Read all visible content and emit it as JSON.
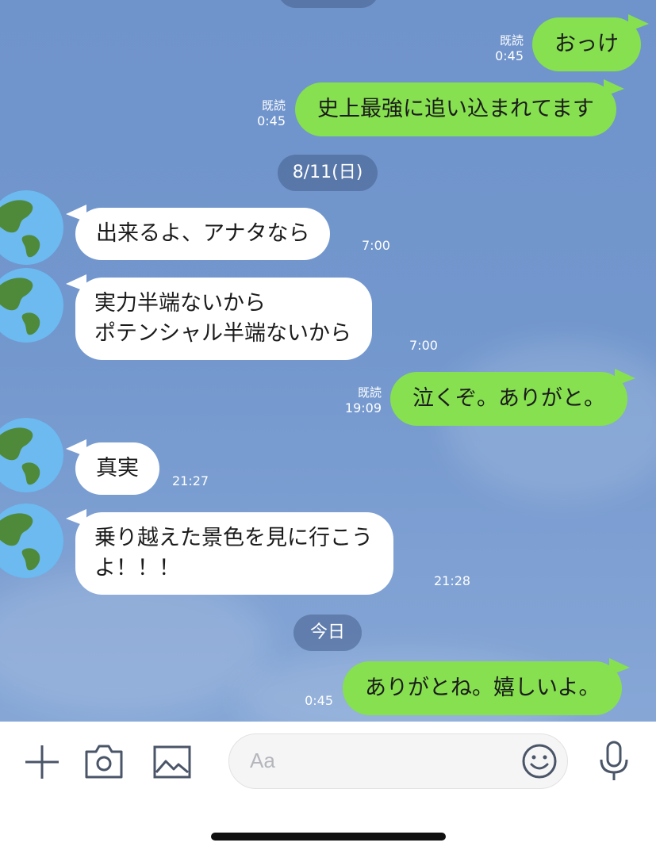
{
  "colors": {
    "chat_background": "#7297cd",
    "outgoing_bubble": "#86e04f",
    "incoming_bubble": "#ffffff",
    "toolbar_icon": "#4a5568"
  },
  "chat": {
    "date_separators": [
      "8/11(日)",
      "今日"
    ],
    "messages": [
      {
        "side": "out",
        "text": "おっけ",
        "read": "既読",
        "time": "0:45"
      },
      {
        "side": "out",
        "text": "史上最強に追い込まれてます",
        "read": "既読",
        "time": "0:45"
      },
      {
        "side": "in",
        "lines": [
          "出来るよ、アナタなら"
        ],
        "time": "7:00"
      },
      {
        "side": "in",
        "lines": [
          "実力半端ないから",
          "ポテンシャル半端ないから"
        ],
        "time": "7:00"
      },
      {
        "side": "out",
        "text": "泣くぞ。ありがと。",
        "read": "既読",
        "time": "19:09"
      },
      {
        "side": "in",
        "lines": [
          "真実"
        ],
        "time": "21:27"
      },
      {
        "side": "in",
        "lines": [
          "乗り越えた景色を見に行こう",
          "よ！！！"
        ],
        "time": "21:28"
      },
      {
        "side": "out",
        "text": "ありがとね。嬉しいよ。",
        "time": "0:45"
      }
    ]
  },
  "toolbar": {
    "icons": [
      "plus-icon",
      "camera-icon",
      "image-icon",
      "smiley-icon",
      "microphone-icon"
    ],
    "input_placeholder": "Aa"
  }
}
